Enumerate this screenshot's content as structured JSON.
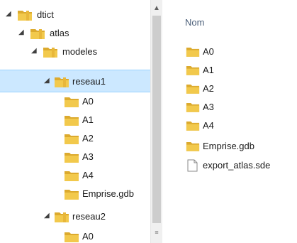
{
  "tree": {
    "items": [
      {
        "label": "dtict",
        "expanded": true
      },
      {
        "label": "atlas",
        "expanded": true
      },
      {
        "label": "modeles",
        "expanded": true
      },
      {
        "label": "reseau1",
        "expanded": true,
        "selected": true
      },
      {
        "label": "A0"
      },
      {
        "label": "A1"
      },
      {
        "label": "A2"
      },
      {
        "label": "A3"
      },
      {
        "label": "A4"
      },
      {
        "label": "Emprise.gdb"
      },
      {
        "label": "reseau2",
        "expanded": true
      },
      {
        "label": "A0"
      }
    ]
  },
  "content": {
    "column_header": "Nom",
    "items": [
      {
        "label": "A0",
        "type": "folder"
      },
      {
        "label": "A1",
        "type": "folder"
      },
      {
        "label": "A2",
        "type": "folder"
      },
      {
        "label": "A3",
        "type": "folder"
      },
      {
        "label": "A4",
        "type": "folder"
      },
      {
        "label": "Emprise.gdb",
        "type": "folder"
      },
      {
        "label": "export_atlas.sde",
        "type": "file"
      }
    ]
  },
  "icons": {
    "expanded_chevron": "chevron-expanded-icon",
    "folder": "folder-icon",
    "file": "file-icon",
    "scroll_up": "scroll-up-arrow-icon",
    "scroll_grip": "scroll-grip-icon"
  },
  "colors": {
    "selection_bg": "#cce8ff",
    "selection_border": "#99d1ff",
    "folder_yellow": "#e8b73a",
    "header_text": "#4c607a"
  }
}
